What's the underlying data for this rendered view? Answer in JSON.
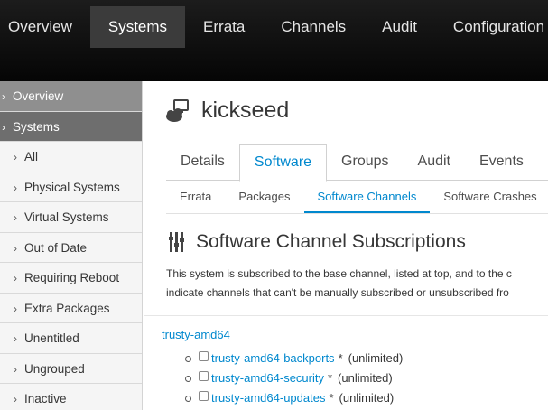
{
  "topnav": {
    "items": [
      {
        "label": "Overview"
      },
      {
        "label": "Systems"
      },
      {
        "label": "Errata"
      },
      {
        "label": "Channels"
      },
      {
        "label": "Audit"
      },
      {
        "label": "Configuration"
      }
    ],
    "active": "Systems"
  },
  "sidebar": {
    "items": [
      {
        "label": "Overview"
      },
      {
        "label": "Systems"
      },
      {
        "label": "All"
      },
      {
        "label": "Physical Systems"
      },
      {
        "label": "Virtual Systems"
      },
      {
        "label": "Out of Date"
      },
      {
        "label": "Requiring Reboot"
      },
      {
        "label": "Extra Packages"
      },
      {
        "label": "Unentitled"
      },
      {
        "label": "Ungrouped"
      },
      {
        "label": "Inactive"
      }
    ]
  },
  "system": {
    "name": "kickseed",
    "icon": "system-icon"
  },
  "tabs": [
    {
      "label": "Details"
    },
    {
      "label": "Software"
    },
    {
      "label": "Groups"
    },
    {
      "label": "Audit"
    },
    {
      "label": "Events"
    }
  ],
  "subtabs": [
    {
      "label": "Errata"
    },
    {
      "label": "Packages"
    },
    {
      "label": "Software Channels"
    },
    {
      "label": "Software Crashes"
    }
  ],
  "section": {
    "heading": "Software Channel Subscriptions",
    "icon": "channel-icon",
    "desc_line1": "This system is subscribed to the base channel, listed at top, and to the c",
    "desc_line2": "indicate channels that can't be manually subscribed or unsubscribed fro"
  },
  "channels": {
    "base": "trusty-amd64",
    "children": [
      {
        "name": "trusty-amd64-backports",
        "star": "*",
        "limit": "(unlimited)"
      },
      {
        "name": "trusty-amd64-security",
        "star": "*",
        "limit": "(unlimited)"
      },
      {
        "name": "trusty-amd64-updates",
        "star": "*",
        "limit": "(unlimited)"
      }
    ]
  },
  "colors": {
    "link": "#0088ce",
    "topbar": "#0a0a0a",
    "sidebar_active": "#6e6e6e"
  }
}
